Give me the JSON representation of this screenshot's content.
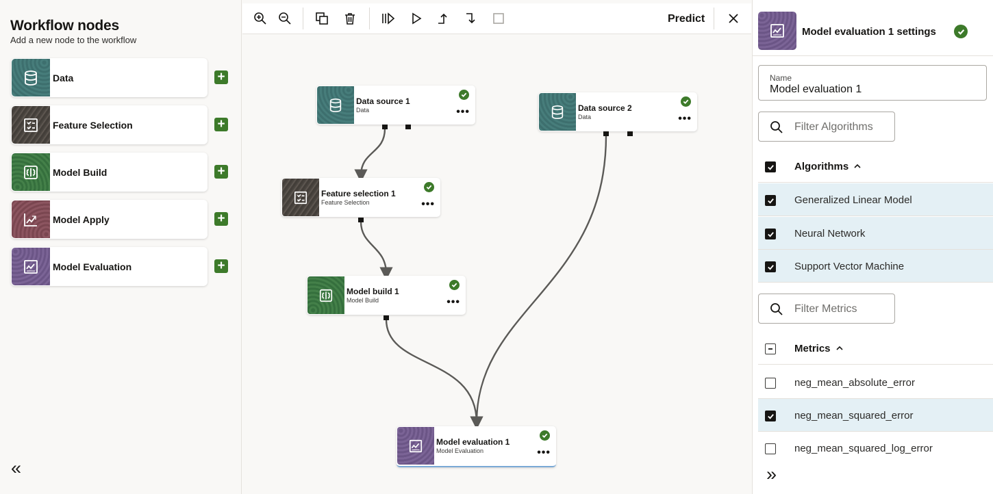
{
  "palette": {
    "title": "Workflow nodes",
    "subtitle": "Add a new node to the workflow",
    "items": [
      {
        "label": "Data",
        "icon": "database-icon"
      },
      {
        "label": "Feature Selection",
        "icon": "checklist-icon"
      },
      {
        "label": "Model Build",
        "icon": "brain-icon"
      },
      {
        "label": "Model Apply",
        "icon": "chart-icon"
      },
      {
        "label": "Model Evaluation",
        "icon": "evaluation-icon"
      }
    ],
    "add_icon": "plus-icon",
    "collapse_glyph": "«"
  },
  "toolbar": {
    "buttons": [
      "zoom-in-icon",
      "zoom-out-icon",
      "duplicate-icon",
      "delete-icon",
      "run-all-icon",
      "run-icon",
      "run-up-icon",
      "run-down-icon",
      "stop-icon"
    ],
    "predict_label": "Predict",
    "close_icon": "close-icon"
  },
  "nodes": [
    {
      "title": "Data source 1",
      "subtitle": "Data",
      "status": "success"
    },
    {
      "title": "Data source 2",
      "subtitle": "Data",
      "status": "success"
    },
    {
      "title": "Feature selection 1",
      "subtitle": "Feature Selection",
      "status": "success"
    },
    {
      "title": "Model build 1",
      "subtitle": "Model Build",
      "status": "success"
    },
    {
      "title": "Model evaluation 1",
      "subtitle": "Model Evaluation",
      "status": "success",
      "selected": true
    }
  ],
  "node_more_glyph": "•••",
  "settings": {
    "title": "Model evaluation 1 settings",
    "name_label": "Name",
    "name_value": "Model evaluation 1",
    "filter_algorithms_placeholder": "Filter Algorithms",
    "algorithms": {
      "header": "Algorithms",
      "header_state": "checked",
      "items": [
        {
          "label": "Generalized Linear Model",
          "checked": true
        },
        {
          "label": "Neural Network",
          "checked": true
        },
        {
          "label": "Support Vector Machine",
          "checked": true
        }
      ]
    },
    "filter_metrics_placeholder": "Filter Metrics",
    "metrics": {
      "header": "Metrics",
      "header_state": "indeterminate",
      "items": [
        {
          "label": "neg_mean_absolute_error",
          "checked": false
        },
        {
          "label": "neg_mean_squared_error",
          "checked": true
        },
        {
          "label": "neg_mean_squared_log_error",
          "checked": false
        }
      ]
    },
    "collapse_glyph": "»"
  },
  "colors": {
    "accent_green": "#3d7a2a",
    "data": "#477d7b",
    "feature": "#4f4944",
    "build": "#3f7a44",
    "apply": "#84505a",
    "evaluation": "#745e90",
    "highlight_row": "#e4f0f5"
  }
}
